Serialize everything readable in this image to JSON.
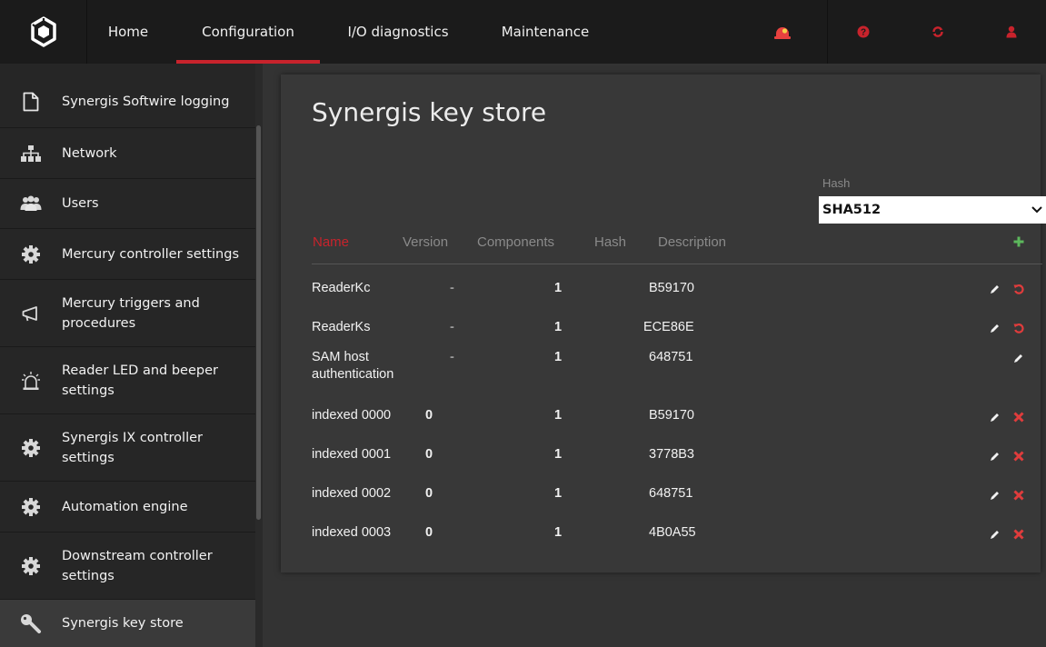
{
  "nav": {
    "tabs": [
      "Home",
      "Configuration",
      "I/O diagnostics",
      "Maintenance"
    ],
    "active_tab": "Configuration",
    "icons": [
      "alarm-bell-icon",
      "help-icon",
      "refresh-icon",
      "user-icon"
    ],
    "accent_color": "#c8232c"
  },
  "sidebar": {
    "items": [
      {
        "label": "Synergis Softwire logging",
        "icon": "document-icon"
      },
      {
        "label": "Network",
        "icon": "network-icon"
      },
      {
        "label": "Users",
        "icon": "users-icon"
      },
      {
        "label": "Mercury controller settings",
        "icon": "gear-icon"
      },
      {
        "label": "Mercury triggers and procedures",
        "icon": "megaphone-icon"
      },
      {
        "label": "Reader LED and beeper settings",
        "icon": "beeper-icon"
      },
      {
        "label": "Synergis IX controller settings",
        "icon": "gear-icon"
      },
      {
        "label": "Automation engine",
        "icon": "gear-icon"
      },
      {
        "label": "Downstream controller settings",
        "icon": "gear-icon"
      },
      {
        "label": "Synergis key store",
        "icon": "key-icon"
      }
    ],
    "active_item": "Synergis key store"
  },
  "page": {
    "title": "Synergis key store",
    "hash_label": "Hash",
    "hash_value": "SHA512"
  },
  "table": {
    "columns": [
      "Name",
      "Version",
      "Components",
      "Hash",
      "Description"
    ],
    "sorted_column": "Name",
    "rows": [
      {
        "name": "ReaderKc",
        "version": "-",
        "components": "1",
        "hash": "B59170",
        "description": "",
        "actions": [
          "edit",
          "revert"
        ]
      },
      {
        "name": "ReaderKs",
        "version": "-",
        "components": "1",
        "hash": "ECE86E",
        "description": "",
        "actions": [
          "edit",
          "revert"
        ]
      },
      {
        "name": "SAM host authentication",
        "name_line1": "SAM host",
        "name_line2": "authentication",
        "version": "-",
        "components": "1",
        "hash": "648751",
        "description": "",
        "actions": [
          "edit"
        ]
      },
      {
        "name": "indexed 0000",
        "version": "0",
        "components": "1",
        "hash": "B59170",
        "description": "",
        "actions": [
          "edit",
          "delete"
        ]
      },
      {
        "name": "indexed 0001",
        "version": "0",
        "components": "1",
        "hash": "3778B3",
        "description": "",
        "actions": [
          "edit",
          "delete"
        ]
      },
      {
        "name": "indexed 0002",
        "version": "0",
        "components": "1",
        "hash": "648751",
        "description": "",
        "actions": [
          "edit",
          "delete"
        ]
      },
      {
        "name": "indexed 0003",
        "version": "0",
        "components": "1",
        "hash": "4B0A55",
        "description": "",
        "actions": [
          "edit",
          "delete"
        ]
      }
    ]
  },
  "colors": {
    "add": "#5cb85c",
    "delete": "#e03c3c",
    "revert": "#e03c3c"
  }
}
